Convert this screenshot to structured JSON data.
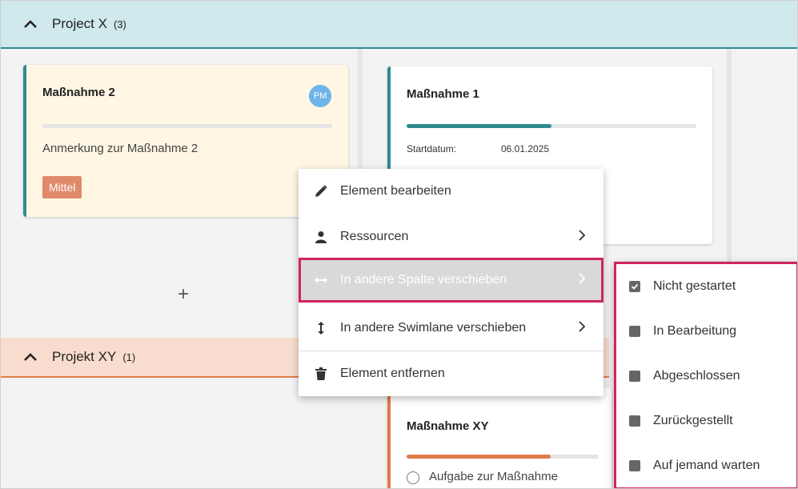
{
  "lanes": {
    "project_x": {
      "title": "Project X",
      "count": "(3)"
    },
    "project_xy": {
      "title": "Projekt XY",
      "count": "(1)"
    }
  },
  "cards": {
    "massnahme2": {
      "title": "Maßnahme 2",
      "avatar": "PM",
      "note": "Anmerkung zur Maßnahme 2",
      "priority": "Mittel",
      "progress": 0
    },
    "massnahme1": {
      "title": "Maßnahme 1",
      "start_label": "Startdatum:",
      "start_value": "06.01.2025",
      "progress": 0.5
    },
    "massnahmexy": {
      "title": "Maßnahme XY",
      "task": "Aufgabe zur Maßnahme",
      "progress": 0.75
    }
  },
  "add_label": "+",
  "context_menu": {
    "items": [
      {
        "label": "Element bearbeiten",
        "icon": "pencil-icon"
      },
      {
        "label": "Ressourcen",
        "icon": "person-icon",
        "submenu": true
      },
      {
        "label": "In andere Spalte verschieben",
        "icon": "horizontal-arrows-icon",
        "submenu": true,
        "highlighted": true
      },
      {
        "label": "In andere Swimlane verschieben",
        "icon": "vertical-arrows-icon",
        "submenu": true
      },
      {
        "label": "Element entfernen",
        "icon": "trash-icon"
      }
    ]
  },
  "submenu": {
    "items": [
      {
        "label": "Nicht gestartet",
        "checked": true
      },
      {
        "label": "In Bearbeitung",
        "checked": false
      },
      {
        "label": "Abgeschlossen",
        "checked": false
      },
      {
        "label": "Zurückgestellt",
        "checked": false
      },
      {
        "label": "Auf jemand warten",
        "checked": false
      }
    ]
  },
  "colors": {
    "teal": "#2e8b8f",
    "orange": "#e07b4a",
    "highlight": "#d0245c"
  }
}
